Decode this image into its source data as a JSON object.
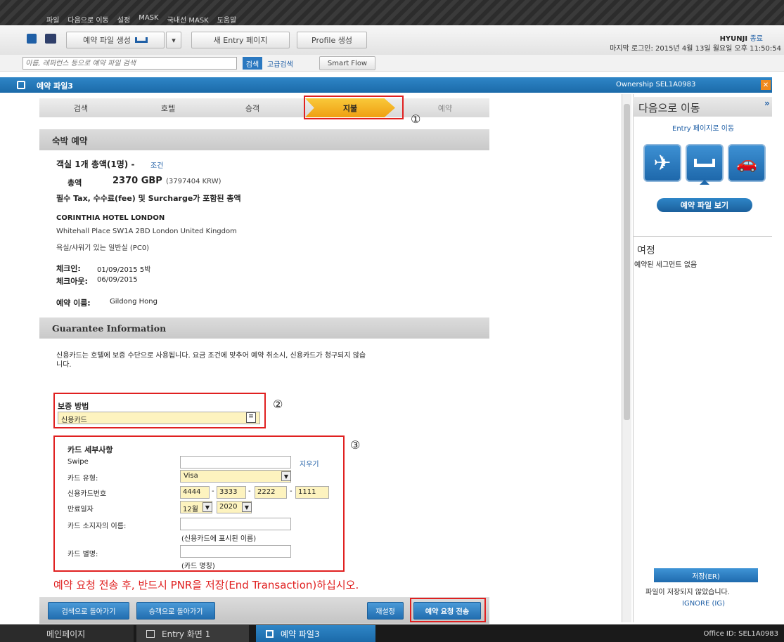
{
  "menu": [
    "파일",
    "다음으로 이동",
    "설정",
    "MASK",
    "국내선 MASK",
    "도움말"
  ],
  "toolbar": {
    "create_pnr": "예약 파일 생성",
    "new_entry": "새 Entry 페이지",
    "profile": "Profile 생성",
    "user": "HYUNJI",
    "logout": "종료",
    "last_login": "마지막 로그인: 2015년 4월 13일 월요일 오후 11:50:54"
  },
  "search": {
    "placeholder": "이름, 레퍼런스 등으로 예약 파일 검색",
    "search_btn": "검색",
    "advanced": "고급검색",
    "smart_flow": "Smart Flow"
  },
  "pnr_bar": {
    "title": "예약 파일3",
    "ownership": "Ownership SEL1A0983"
  },
  "steps": [
    "검색",
    "호텔",
    "승객",
    "지불",
    "예약"
  ],
  "active_step": "지불",
  "booking": {
    "section_title": "숙박 예약",
    "room_total_label": "객실 1개 총액(1명) -",
    "conditions_link": "조건",
    "total_label": "총액",
    "total_value": "2370 GBP",
    "total_krw": "(3797404 KRW)",
    "tax_note": "필수 Tax, 수수료(fee) 및 Surcharge가 포함된 총액",
    "hotel_name": "CORINTHIA HOTEL LONDON",
    "hotel_address": "Whitehall Place SW1A 2BD London United Kingdom",
    "room_type": "욕실/샤워기 있는 일반실 (PC0)",
    "checkin_label": "체크인:",
    "checkin_value": "01/09/2015   5박",
    "checkout_label": "체크아웃:",
    "checkout_value": "06/09/2015",
    "name_label": "예약 이름:",
    "name_value": "Gildong Hong"
  },
  "guarantee": {
    "section_title": "Guarantee Information",
    "note_line1": "신용카드는 호텔에 보증 수단으로 사용됩니다. 요금 조건에 맞추어 예약 취소시, 신용카드가 청구되지 않습",
    "note_line2": "니다.",
    "method_label": "보증 방법",
    "method_value": "신용카드"
  },
  "card": {
    "title": "카드 세부사항",
    "swipe_label": "Swipe",
    "clear_link": "지우기",
    "type_label": "카드 유형:",
    "type_value": "Visa",
    "number_label": "신용카드번호",
    "number_parts": [
      "4444",
      "3333",
      "2222",
      "1111"
    ],
    "expiry_label": "만료일자",
    "expiry_month": "12월",
    "expiry_year": "2020",
    "holder_label": "카드 소지자의 이름:",
    "holder_hint": "(신용카드에 표시된 이름)",
    "alias_label": "카드 별명:",
    "alias_hint": "(카드 명칭)"
  },
  "annotations": {
    "c1": "①",
    "c2": "②",
    "c3": "③"
  },
  "warning": "예약 요청 전송 후, 반드시 PNR을 저장(End Transaction)하십시오.",
  "bottom_buttons": {
    "back_search": "검색으로 돌아가기",
    "back_passenger": "승객으로 돌아가기",
    "reset": "재설정",
    "send": "예약 요청 전송"
  },
  "right_panel": {
    "goto_title": "다음으로 이동",
    "entry_link": "Entry 페이지로 이동",
    "view_pnr": "예약 파일 보기",
    "itinerary_title": "여정",
    "no_segments": "예약된 세그먼트 없음",
    "save_btn": "저장(ER)",
    "not_saved": "파일이 저장되지 않았습니다.",
    "ignore": "IGNORE (IG)"
  },
  "taskbar": {
    "main": "메인페이지",
    "entry": "Entry 화면 1",
    "pnr": "예약 파일3",
    "office": "Office ID: SEL1A0983"
  },
  "colors": {
    "accent_blue": "#1b6aa9",
    "step_active": "#f5b416",
    "annotation_red": "#e02020",
    "yellow_field": "#fdf3bf"
  }
}
